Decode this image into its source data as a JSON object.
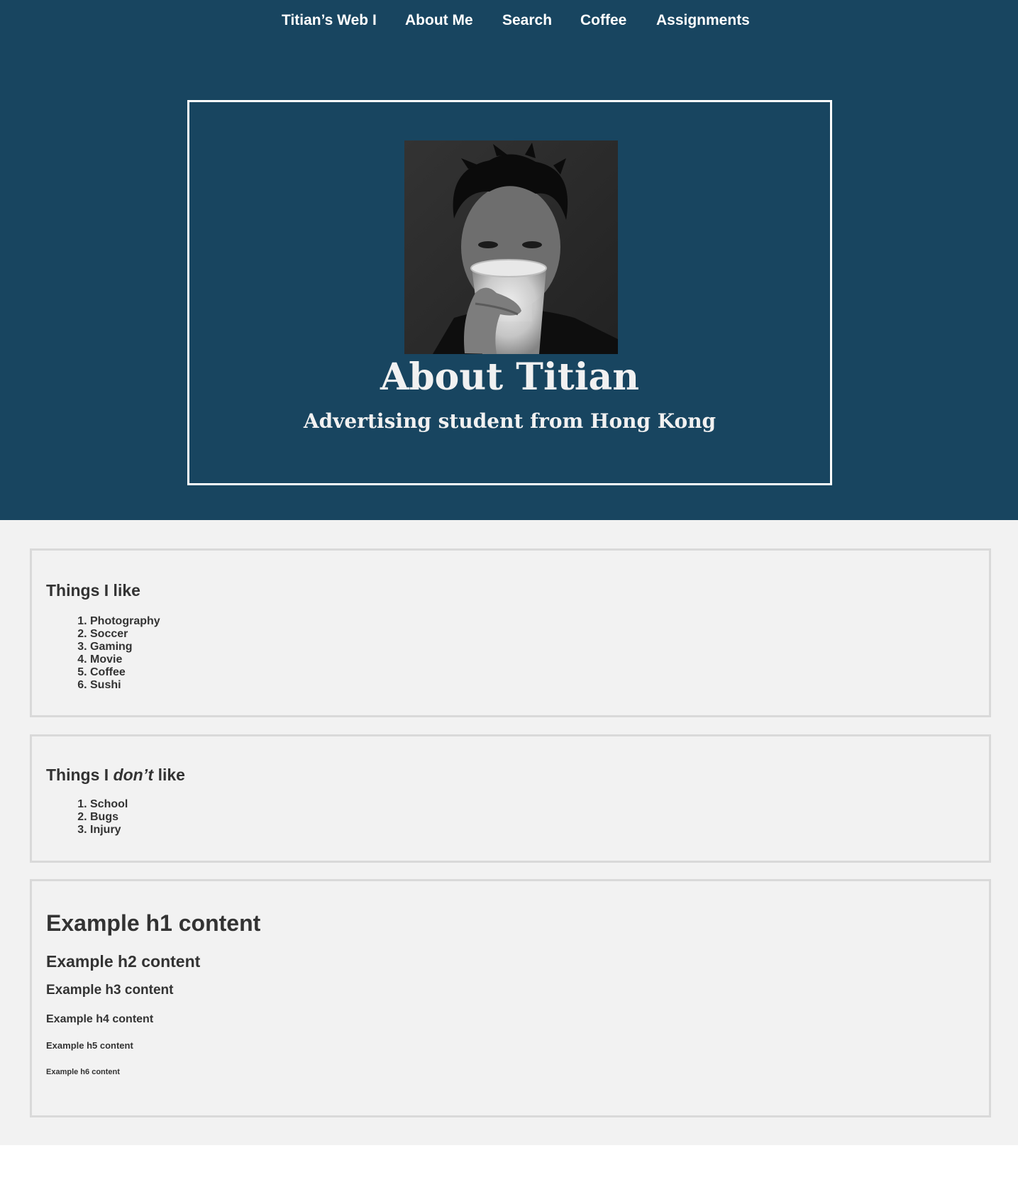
{
  "nav": {
    "items": [
      {
        "label": "Titian’s Web I"
      },
      {
        "label": "About Me"
      },
      {
        "label": "Search"
      },
      {
        "label": "Coffee"
      },
      {
        "label": "Assignments"
      }
    ]
  },
  "hero": {
    "title": "About Titian",
    "subtitle": "Advertising student from Hong Kong"
  },
  "likes": {
    "title": "Things I like",
    "items": [
      "Photography",
      "Soccer",
      "Gaming",
      "Movie",
      "Coffee",
      "Sushi"
    ]
  },
  "dislikes": {
    "title_start": "Things I ",
    "title_emph": "don’t",
    "title_end": " like",
    "items": [
      "School",
      "Bugs",
      "Injury"
    ]
  },
  "examples": {
    "h1": "Example h1 content",
    "h2": "Example h2 content",
    "h3": "Example h3 content",
    "h4": "Example h4 content",
    "h5": "Example h5 content",
    "h6": "Example h6 content"
  },
  "colors": {
    "hero_bg": "#184560",
    "content_bg": "#f2f2f2",
    "card_border": "#d9d9d9",
    "text": "#333333"
  }
}
